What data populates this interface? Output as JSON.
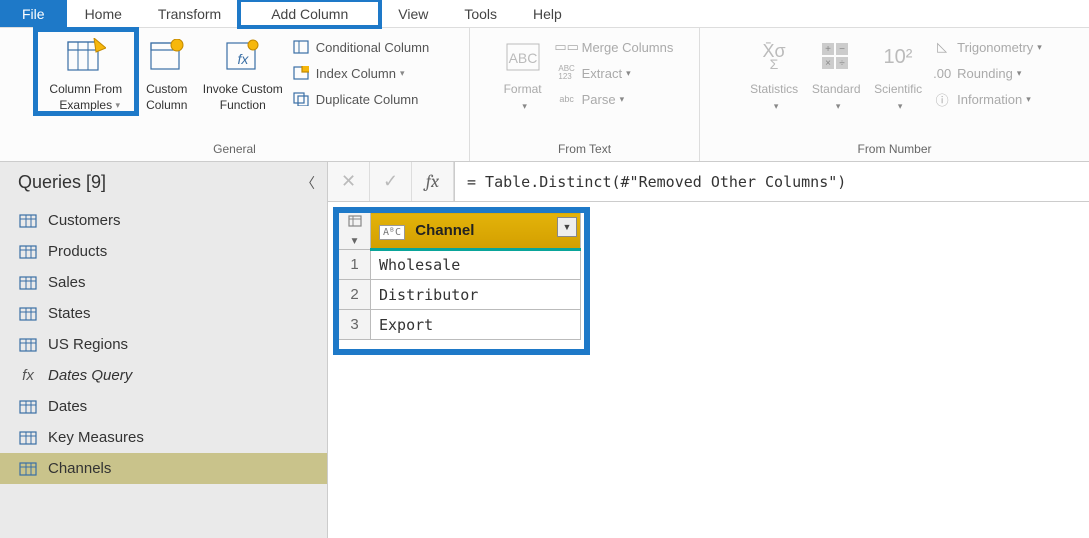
{
  "menubar": {
    "file": "File",
    "tabs": [
      "Home",
      "Transform",
      "Add Column",
      "View",
      "Tools",
      "Help"
    ]
  },
  "ribbon": {
    "general": {
      "label": "General",
      "column_from_examples": "Column From\nExamples",
      "custom_column": "Custom\nColumn",
      "invoke_custom_function": "Invoke Custom\nFunction",
      "conditional_column": "Conditional Column",
      "index_column": "Index Column",
      "duplicate_column": "Duplicate Column"
    },
    "from_text": {
      "label": "From Text",
      "format": "Format",
      "merge_columns": "Merge Columns",
      "extract": "Extract",
      "parse": "Parse"
    },
    "from_number": {
      "label": "From Number",
      "statistics": "Statistics",
      "standard": "Standard",
      "scientific": "Scientific",
      "trigonometry": "Trigonometry",
      "rounding": "Rounding",
      "information": "Information"
    }
  },
  "sidebar": {
    "title": "Queries [9]",
    "items": [
      {
        "label": "Customers",
        "kind": "table"
      },
      {
        "label": "Products",
        "kind": "table"
      },
      {
        "label": "Sales",
        "kind": "table"
      },
      {
        "label": "States",
        "kind": "table"
      },
      {
        "label": "US Regions",
        "kind": "table"
      },
      {
        "label": "Dates Query",
        "kind": "fx"
      },
      {
        "label": "Dates",
        "kind": "table"
      },
      {
        "label": "Key Measures",
        "kind": "table"
      },
      {
        "label": "Channels",
        "kind": "table",
        "selected": true
      }
    ]
  },
  "formula_bar": {
    "text": "= Table.Distinct(#\"Removed Other Columns\")"
  },
  "grid": {
    "column_header": "Channel",
    "rows": [
      "Wholesale",
      "Distributor",
      "Export"
    ]
  }
}
